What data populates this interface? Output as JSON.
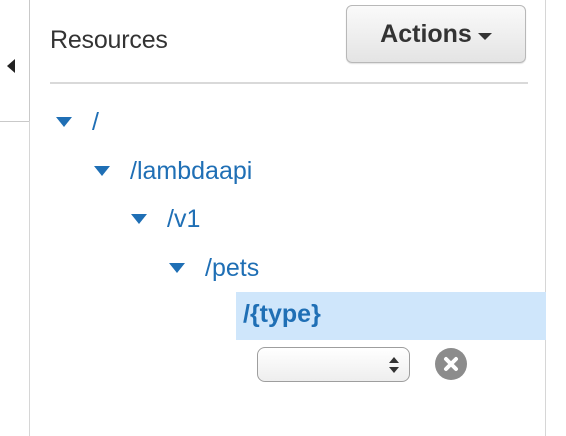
{
  "header": {
    "title": "Resources",
    "actions_label": "Actions"
  },
  "icons": {
    "collapse": "collapse-left-icon",
    "toggle": "caret-down-icon",
    "select": "select-arrows-icon",
    "clear": "clear-x-icon"
  },
  "colors": {
    "link": "#1f6fb5",
    "selected_bg": "#cfe6fb",
    "text": "#333333"
  },
  "tree": {
    "items": [
      {
        "label": "/",
        "expanded": true
      },
      {
        "label": "/lambdaapi",
        "expanded": true
      },
      {
        "label": "/v1",
        "expanded": true
      },
      {
        "label": "/pets",
        "expanded": true
      },
      {
        "label": "/{type}",
        "selected": true
      }
    ]
  },
  "method_select": {
    "value": ""
  }
}
